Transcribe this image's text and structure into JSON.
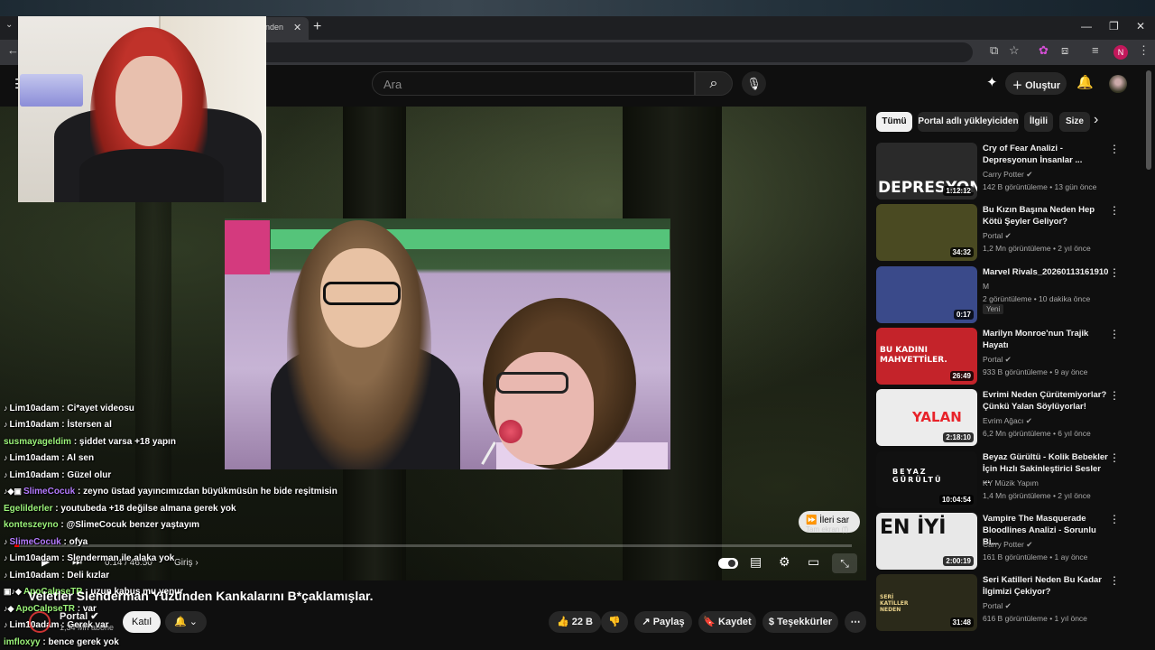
{
  "browser": {
    "tab_title": "nden",
    "profile_initial": "N"
  },
  "header": {
    "search_placeholder": "Ara",
    "create_label": "Oluştur"
  },
  "player": {
    "time": "0:14 / 46:50",
    "chapter": "Giriş",
    "skip_label": "İleri sar",
    "skip_tooltip": "Tam ekran (f)",
    "progress_fraction": 0.005
  },
  "chat": [
    {
      "badges": "",
      "user": "",
      "color": "#ffffff",
      "text": ""
    },
    {
      "badges": "♪",
      "user": "Lim10adam",
      "color": "#ffffff",
      "text": ": Ci*ayet videosu"
    },
    {
      "badges": "♪",
      "user": "Lim10adam",
      "color": "#ffffff",
      "text": ": İstersen al"
    },
    {
      "badges": "",
      "user": "susmayageldim",
      "color": "#9cf47a",
      "text": ": şiddet varsa +18 yapın"
    },
    {
      "badges": "♪",
      "user": "Lim10adam",
      "color": "#ffffff",
      "text": ": Al sen"
    },
    {
      "badges": "♪",
      "user": "Lim10adam",
      "color": "#ffffff",
      "text": ": Güzel olur"
    },
    {
      "badges": "♪◆▣",
      "user": "SlimeCocuk",
      "color": "#b57bff",
      "text": ": zeyno üstad yayıncımızdan büyükmüsün he bide reşitmisin"
    },
    {
      "badges": "",
      "user": "Egelilderler",
      "color": "#9cf47a",
      "text": ": youtubeda +18 değilse almana gerek yok"
    },
    {
      "badges": "",
      "user": "konteszeyno",
      "color": "#9cf47a",
      "text": ": @SlimeCocuk benzer yaştayım"
    },
    {
      "badges": "♪",
      "user": "SlimeCocuk",
      "color": "#b57bff",
      "text": ": ofya"
    },
    {
      "badges": "♪",
      "user": "Lim10adam",
      "color": "#ffffff",
      "text": ": Slenderman ile alaka yok"
    },
    {
      "badges": "♪",
      "user": "Lim10adam",
      "color": "#ffffff",
      "text": ": Deli kızlar"
    },
    {
      "badges": "▣♪◆",
      "user": "ApoCalpseTR",
      "color": "#9cf47a",
      "text": ": uzun kabus mu yenur"
    },
    {
      "badges": "♪◆",
      "user": "ApoCalpseTR",
      "color": "#9cf47a",
      "text": ": var"
    },
    {
      "badges": "♪",
      "user": "Lim10adam",
      "color": "#ffffff",
      "text": ": Gerek var"
    },
    {
      "badges": "",
      "user": "imfloxyy",
      "color": "#9cf47a",
      "text": ": bence gerek yok"
    }
  ],
  "video": {
    "title": "Veletler Slenderman Yüzünden Kankalarını B*çaklamışlar.",
    "channel": "Portal",
    "subs": "1,34 Mn abone",
    "join": "Katıl",
    "likes": "22 B",
    "share": "Paylaş",
    "save": "Kaydet",
    "thanks": "Teşekkürler"
  },
  "chips": [
    "Tümü",
    "Portal adlı yükleyiciden",
    "İlgili",
    "Size"
  ],
  "recommendations": [
    {
      "title": "Cry of Fear Analizi - Depresyonun İnsanlar ...",
      "channel": "Carry Potter",
      "verified": true,
      "meta": "142 B görüntüleme • 13 gün önce",
      "duration": "1:12:12",
      "thumb_text": "DEPRESYON",
      "thumb_color": "#2a2a2a",
      "badge": ""
    },
    {
      "title": "Bu Kızın Başına Neden Hep Kötü Şeyler Geliyor?",
      "channel": "Portal",
      "verified": true,
      "meta": "1,2 Mn görüntüleme • 2 yıl önce",
      "duration": "34:32",
      "thumb_text": "",
      "thumb_color": "#4a4a22",
      "badge": ""
    },
    {
      "title": "Marvel Rivals_20260113161910",
      "channel": "M",
      "verified": false,
      "meta": "2 görüntüleme • 10 dakika önce",
      "duration": "0:17",
      "thumb_text": "",
      "thumb_color": "#3a4a8a",
      "badge": "Yeni"
    },
    {
      "title": "Marilyn Monroe'nun Trajik Hayatı",
      "channel": "Portal",
      "verified": true,
      "meta": "933 B görüntüleme • 9 ay önce",
      "duration": "26:49",
      "thumb_text": "BU KADINI MAHVETTİLER.",
      "thumb_color": "#c4232a",
      "badge": ""
    },
    {
      "title": "Evrimi Neden Çürütemiyorlar? Çünkü Yalan Söylüyorlar!",
      "channel": "Evrim Ağacı",
      "verified": true,
      "meta": "6,2 Mn görüntüleme • 6 yıl önce",
      "duration": "2:18:10",
      "thumb_text": "YALAN",
      "thumb_color": "#ececec",
      "badge": ""
    },
    {
      "title": "Beyaz Gürültü - Kolik Bebekler İçin Hızlı Sakinleştirici Sesler ...",
      "channel": "KY Müzik Yapım",
      "verified": false,
      "meta": "1,4 Mn görüntüleme • 2 yıl önce",
      "duration": "10:04:54",
      "thumb_text": "BEYAZ GÜRÜLTÜ",
      "thumb_color": "#111111",
      "badge": ""
    },
    {
      "title": "Vampire The Masquerade Bloodlines Analizi - Sorunlu Bi...",
      "channel": "Carry Potter",
      "verified": true,
      "meta": "161 B görüntüleme • 1 ay önce",
      "duration": "2:00:19",
      "thumb_text": "EN İYİ",
      "thumb_color": "#e8e8e8",
      "badge": ""
    },
    {
      "title": "Seri Katilleri Neden Bu Kadar İlgimizi Çekiyor?",
      "channel": "Portal",
      "verified": true,
      "meta": "616 B görüntüleme • 1 yıl önce",
      "duration": "31:48",
      "thumb_text": "SERİ KATİLLER NEDEN",
      "thumb_color": "#2b2a1a",
      "badge": ""
    }
  ]
}
